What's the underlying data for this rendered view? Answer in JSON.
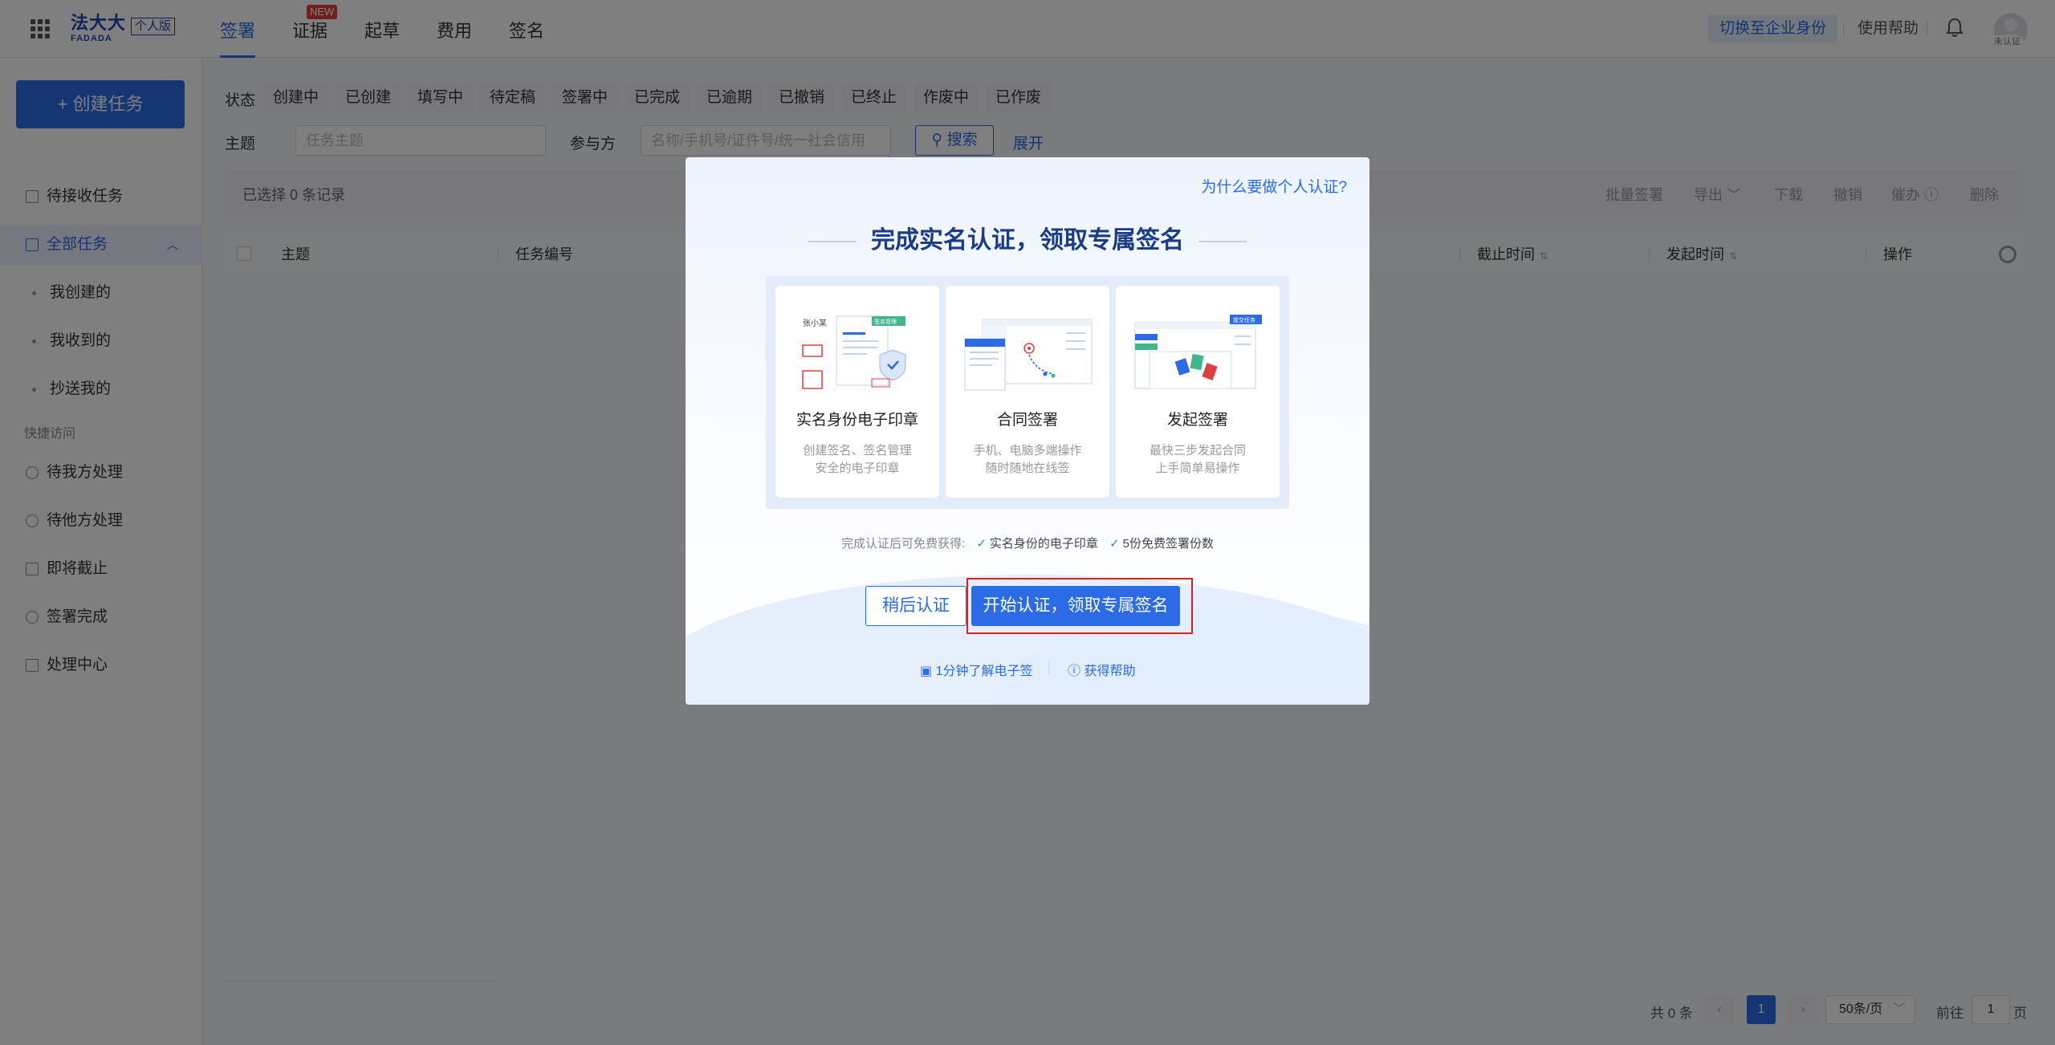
{
  "header": {
    "logo_cn": "法大大",
    "logo_en": "FADADA",
    "logo_badge": "个人版",
    "tabs": [
      {
        "label": "签署",
        "active": true
      },
      {
        "label": "证据",
        "badge": "NEW"
      },
      {
        "label": "起草"
      },
      {
        "label": "费用"
      },
      {
        "label": "签名"
      }
    ],
    "switch_label": "切换至企业身份",
    "help_label": "使用帮助",
    "avatar_status": "未认证"
  },
  "sidebar": {
    "create_label": "+ 创建任务",
    "items": [
      {
        "label": "待接收任务"
      },
      {
        "label": "全部任务",
        "active": true
      }
    ],
    "sub_items": [
      "我创建的",
      "我收到的",
      "抄送我的"
    ],
    "quick_caption": "快捷访问",
    "quick_items": [
      "待我方处理",
      "待他方处理",
      "即将截止",
      "签署完成",
      "处理中心"
    ]
  },
  "filters": {
    "status_label": "状态",
    "statuses": [
      "创建中",
      "已创建",
      "填写中",
      "待定稿",
      "签署中",
      "已完成",
      "已逾期",
      "已撤销",
      "已终止",
      "作废中",
      "已作废"
    ],
    "subject_label": "主题",
    "subject_placeholder": "任务主题",
    "party_label": "参与方",
    "party_placeholder": "名称/手机号/证件号/统一社会信用",
    "search_label": "搜索",
    "expand_label": "展开"
  },
  "selection": {
    "text": "已选择 0 条记录",
    "actions": [
      "批量签署",
      "导出",
      "下载",
      "撤销",
      "催办",
      "删除"
    ]
  },
  "table": {
    "columns": [
      "主题",
      "任务编号",
      "截止时间",
      "发起时间",
      "操作"
    ]
  },
  "pagination": {
    "total": "共 0 条",
    "current": "1",
    "page_size": "50条/页",
    "goto_label": "前往",
    "goto_value": "1",
    "page_suffix": "页"
  },
  "modal": {
    "why_link": "为什么要做个人认证?",
    "title": "完成实名认证，领取专属签名",
    "cards": [
      {
        "title": "实名身份电子印章",
        "desc1": "创建签名、签名管理",
        "desc2": "安全的电子印章",
        "tag": "签名管理",
        "sig_text": "张小某"
      },
      {
        "title": "合同签署",
        "desc1": "手机、电脑多端操作",
        "desc2": "随时随地在线签"
      },
      {
        "title": "发起签署",
        "desc1": "最快三步发起合同",
        "desc2": "上手简单易操作",
        "tag": "提交任务"
      }
    ],
    "benefits_prefix": "完成认证后可免费获得:",
    "benefits": [
      "实名身份的电子印章",
      "5份免费签署份数"
    ],
    "later_label": "稍后认证",
    "start_label": "开始认证，领取专属签名",
    "foot_links": [
      "1分钟了解电子签",
      "获得帮助"
    ]
  },
  "colors": {
    "accent": "#2b6be6",
    "highlight": "#e02020",
    "check": "#21a366"
  }
}
